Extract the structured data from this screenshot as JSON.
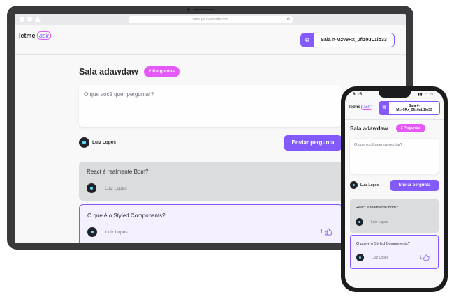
{
  "browser": {
    "url": "www.your-website.com"
  },
  "app": {
    "logo_main": "letme",
    "logo_accent": "ask",
    "room_code_label": "Sala #-Mzv9Rx_0fiz0uL1lo33",
    "room_title": "Sala adawdaw",
    "question_count_badge": "2 Perguntas",
    "textarea_placeholder": "O que você quer perguntar?",
    "user_name": "Luiz Lopes",
    "send_button": "Enviar pergunta",
    "questions": [
      {
        "text": "React é realmente Bom?",
        "author": "Luiz Lopes",
        "state": "answered"
      },
      {
        "text": "O que é o Styled Components?",
        "author": "Luiz Lopes",
        "state": "highlighted",
        "likes": "1"
      }
    ]
  },
  "phone": {
    "time": "8:15",
    "room_code_line1": "Sala #-",
    "room_code_line2": "Mzv9Rx_0fiz0uL1lo33"
  },
  "colors": {
    "primary": "#835afd",
    "accent": "#e559f9",
    "text": "#29292e",
    "muted": "#737380",
    "answered_bg": "#dbdcdd",
    "highlight_bg": "#f4f0ff"
  },
  "icons": {
    "copy": "copy-icon",
    "like": "thumbs-up-icon",
    "avatar": "react-logo-avatar",
    "search": "search-icon"
  }
}
